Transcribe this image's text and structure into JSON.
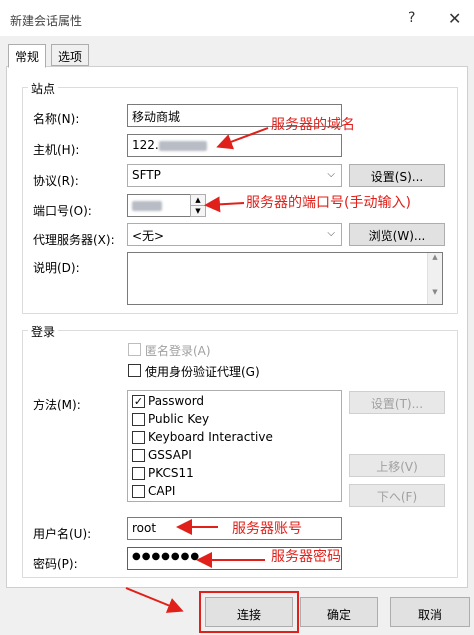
{
  "window": {
    "title": "新建会话属性",
    "help_glyph": "?",
    "close_glyph": "✕"
  },
  "tabs": [
    {
      "label": "常规"
    },
    {
      "label": "选项"
    }
  ],
  "site": {
    "group_title": "站点",
    "name_label": "名称(N):",
    "name_value": "移动商城",
    "host_label": "主机(H):",
    "host_value": "122.",
    "protocol_label": "协议(R):",
    "protocol_value": "SFTP",
    "settings_button": "设置(S)...",
    "port_label": "端口号(O):",
    "proxy_label": "代理服务器(X):",
    "proxy_value": "<无>",
    "browse_button": "浏览(W)...",
    "description_label": "说明(D):",
    "description_value": ""
  },
  "login": {
    "group_title": "登录",
    "anonymous_label": "匿名登录(A)",
    "identity_agent_label": "使用身份验证代理(G)",
    "method_label": "方法(M):",
    "methods": [
      {
        "label": "Password",
        "checked": true
      },
      {
        "label": "Public Key",
        "checked": false
      },
      {
        "label": "Keyboard Interactive",
        "checked": false
      },
      {
        "label": "GSSAPI",
        "checked": false
      },
      {
        "label": "PKCS11",
        "checked": false
      },
      {
        "label": "CAPI",
        "checked": false
      }
    ],
    "method_settings_button": "设置(T)...",
    "move_up_button": "上移(V)",
    "move_down_button": "下へ(F)",
    "username_label": "用户名(U):",
    "username_value": "root",
    "password_label": "密码(P):",
    "password_value": "●●●●●●●"
  },
  "annotations": {
    "host": "服务器的域名",
    "port": "服务器的端口号(手动输入)",
    "username": "服务器账号",
    "password": "服务器密码"
  },
  "footer": {
    "connect_button": "连接",
    "ok_button": "确定",
    "cancel_button": "取消"
  },
  "colors": {
    "annotation": "#e0201a",
    "dialog_bg": "#f0f0f0",
    "button_bg": "#e1e1e1"
  }
}
